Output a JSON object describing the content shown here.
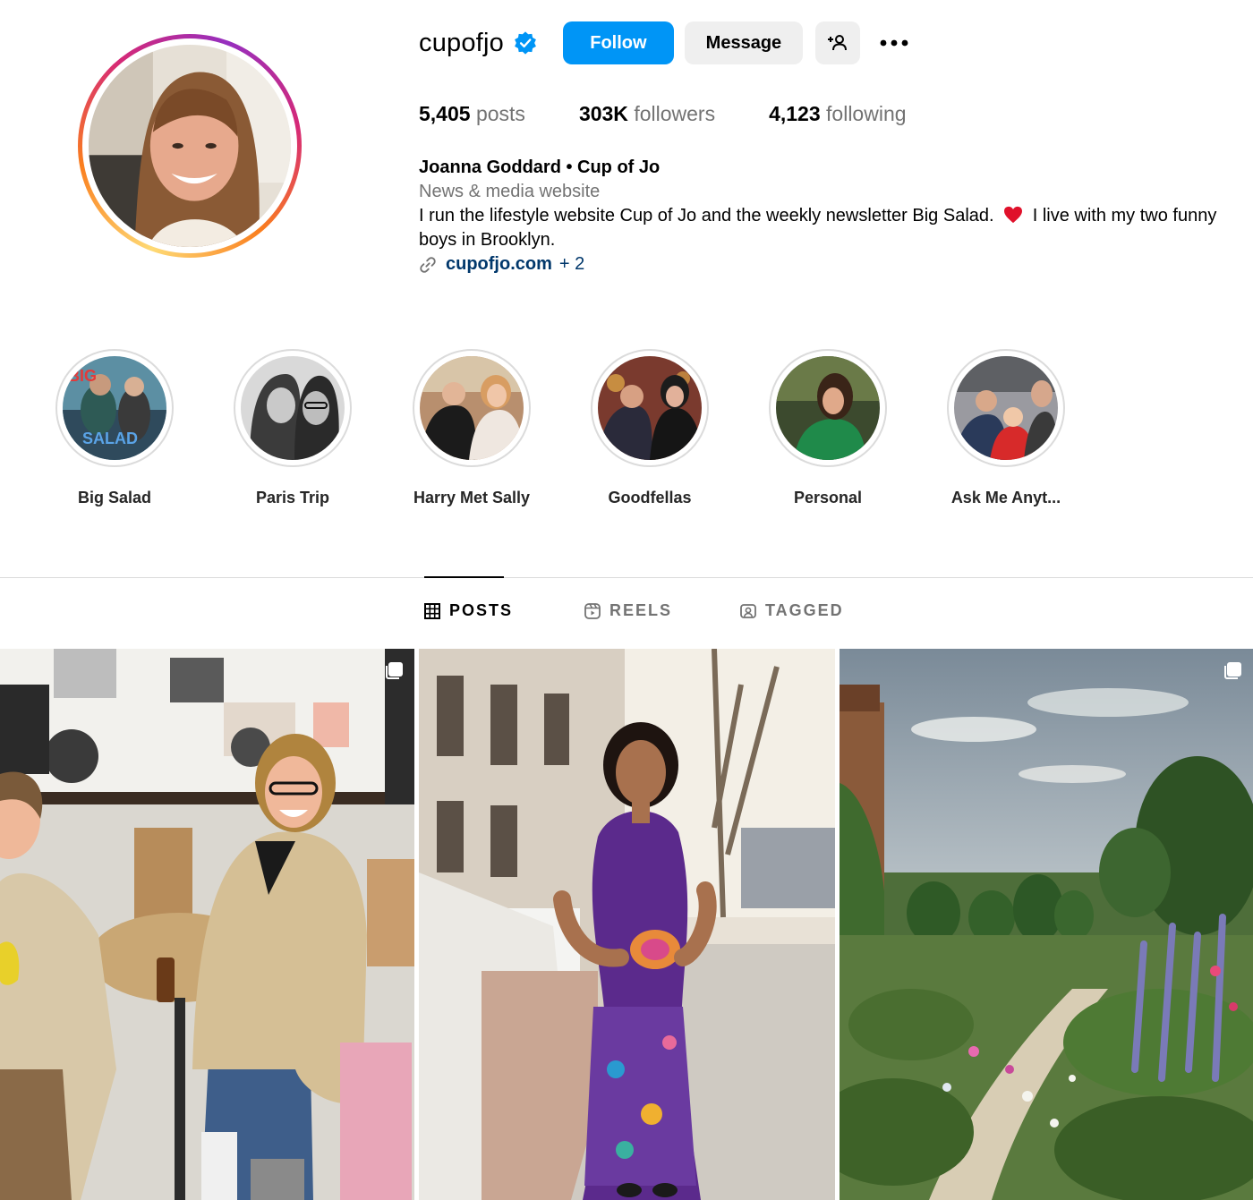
{
  "profile": {
    "username": "cupofjo",
    "verified": true,
    "avatar_alt": "profile-photo",
    "buttons": {
      "follow": "Follow",
      "message": "Message"
    },
    "stats": {
      "posts_value": "5,405",
      "posts_label": "posts",
      "followers_value": "303K",
      "followers_label": "followers",
      "following_value": "4,123",
      "following_label": "following"
    },
    "bio": {
      "full_name": "Joanna Goddard • Cup of Jo",
      "category": "News & media website",
      "text_part1": "I run the lifestyle website Cup of Jo and the weekly newsletter Big Salad.",
      "text_part2": "I live with my two funny boys in Brooklyn.",
      "link_text": "cupofjo.com",
      "link_more": "+ 2"
    }
  },
  "highlights": [
    {
      "label": "Big Salad"
    },
    {
      "label": "Paris Trip"
    },
    {
      "label": "Harry Met Sally"
    },
    {
      "label": "Goodfellas"
    },
    {
      "label": "Personal"
    },
    {
      "label": "Ask Me Anyt..."
    }
  ],
  "tabs": [
    {
      "label": "POSTS",
      "active": true
    },
    {
      "label": "REELS",
      "active": false
    },
    {
      "label": "TAGGED",
      "active": false
    }
  ],
  "colors": {
    "accent": "#0095f6",
    "link": "#00376b",
    "muted": "#737373",
    "button_secondary": "#efefef",
    "divider": "#dbdbdb"
  },
  "icons": {
    "verified": "verified-badge-icon",
    "suggest": "add-person-icon",
    "more": "more-options-icon",
    "link": "link-icon",
    "heart": "red-heart-icon",
    "posts_tab": "grid-icon",
    "reels_tab": "reels-icon",
    "tagged_tab": "tagged-icon",
    "multi_post": "carousel-icon"
  }
}
